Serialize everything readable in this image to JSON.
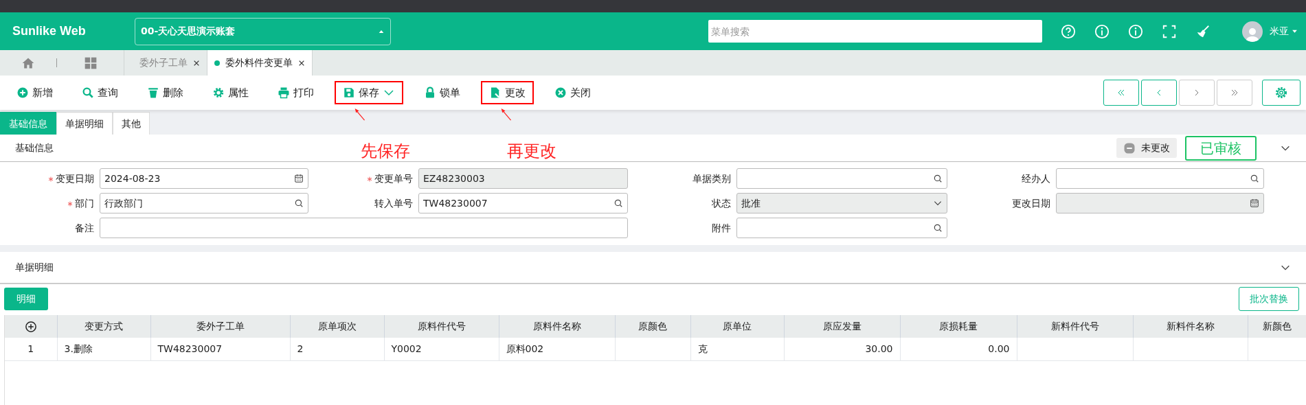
{
  "header": {
    "logo": "Sunlike Web",
    "account": "00-天心天思演示账套",
    "search": {
      "placeholder": "菜单搜索"
    },
    "user": "米亚"
  },
  "open_tabs": [
    {
      "label": "委外子工单",
      "selected": false
    },
    {
      "label": "委外料件变更单",
      "selected": true
    }
  ],
  "toolbar": [
    {
      "label": "新增",
      "kind": "add",
      "dropdown": false
    },
    {
      "label": "查询",
      "kind": "search",
      "dropdown": false
    },
    {
      "label": "删除",
      "kind": "delete",
      "dropdown": false
    },
    {
      "label": "属性",
      "kind": "settings",
      "dropdown": false
    },
    {
      "label": "打印",
      "kind": "print",
      "dropdown": false
    },
    {
      "label": "保存",
      "kind": "save",
      "dropdown": true,
      "note": "先保存"
    },
    {
      "label": "锁单",
      "kind": "lock",
      "dropdown": false
    },
    {
      "label": "更改",
      "kind": "edit",
      "dropdown": false,
      "note": "再更改"
    },
    {
      "label": "关闭",
      "kind": "close",
      "dropdown": false
    }
  ],
  "pager": [
    {
      "kind": "first",
      "enabled": true
    },
    {
      "kind": "prev",
      "enabled": true
    },
    {
      "kind": "next",
      "enabled": false
    },
    {
      "kind": "last",
      "enabled": false
    }
  ],
  "form_tabs": [
    {
      "label": "基础信息",
      "selected": true
    },
    {
      "label": "单据明细",
      "selected": false
    },
    {
      "label": "其他",
      "selected": false
    }
  ],
  "basic_info": {
    "title": "基础信息",
    "change_status": "未更改",
    "approval_stamp": "已审核",
    "expanded": true,
    "fields": [
      {
        "label": "变更日期",
        "required": true,
        "kind": "date",
        "value": "2024-08-23",
        "readonly": false
      },
      {
        "label": "变更单号",
        "required": true,
        "kind": "text",
        "value": "EZ48230003",
        "readonly": true
      },
      {
        "label": "单据类别",
        "required": false,
        "kind": "lookup",
        "readonly": false
      },
      {
        "label": "经办人",
        "required": false,
        "kind": "lookup",
        "readonly": false
      },
      {
        "label": "部门",
        "required": true,
        "kind": "lookup",
        "value": "行政部门",
        "readonly": false
      },
      {
        "label": "转入单号",
        "required": false,
        "kind": "lookup",
        "value": "TW48230007",
        "readonly": false
      },
      {
        "label": "状态",
        "required": false,
        "kind": "select",
        "value": "批准",
        "readonly": true
      },
      {
        "label": "更改日期",
        "required": false,
        "kind": "date",
        "readonly": true
      },
      {
        "label": "备注",
        "required": false,
        "kind": "memo",
        "readonly": false
      },
      {
        "label": "附件",
        "required": false,
        "kind": "lookup",
        "readonly": false
      }
    ]
  },
  "detail": {
    "title": "单据明细",
    "expanded": true,
    "tab": "明细",
    "batch_button": "批次替换",
    "columns": [
      {
        "label": "变更方式",
        "kind": "text"
      },
      {
        "label": "委外子工单",
        "kind": "text"
      },
      {
        "label": "原单项次",
        "kind": "text"
      },
      {
        "label": "原料件代号",
        "kind": "text"
      },
      {
        "label": "原料件名称",
        "kind": "text"
      },
      {
        "label": "原颜色",
        "kind": "text"
      },
      {
        "label": "原单位",
        "kind": "text"
      },
      {
        "label": "原应发量",
        "kind": "number"
      },
      {
        "label": "原损耗量",
        "kind": "number"
      },
      {
        "label": "新料件代号",
        "kind": "text"
      },
      {
        "label": "新料件名称",
        "kind": "text"
      },
      {
        "label": "新颜色",
        "kind": "text"
      }
    ],
    "rows": [
      {
        "no": "1",
        "cells": [
          "3.删除",
          "TW48230007",
          "2",
          "Y0002",
          "原料002",
          null,
          "克",
          "30.00",
          "0.00",
          null,
          null,
          null
        ]
      }
    ]
  }
}
